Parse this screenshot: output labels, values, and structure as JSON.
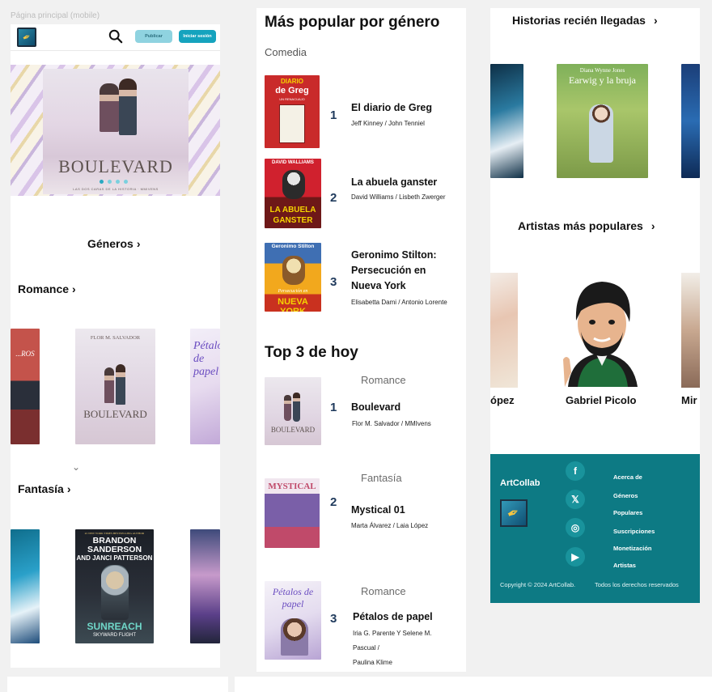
{
  "frame_label": "Página principal (mobile)",
  "header": {
    "publish_label": "Publicar",
    "login_label": "Iniciar sesión"
  },
  "hero": {
    "title": "BOULEVARD",
    "subtitle": "LAS DOS CARAS DE LA HISTORIA · MMIVENS",
    "slides": 4,
    "active_slide": 1
  },
  "genres_link": "Géneros",
  "sections": [
    {
      "title": "Romance",
      "books": [
        {
          "label": "...ROS",
          "color": "#c4534b"
        },
        {
          "label": "BOULEVARD",
          "author": "FLOR M. SALVADOR"
        },
        {
          "label": "Pétalos de papel",
          "color": "#6a4cc0"
        }
      ]
    },
    {
      "title": "Fantasía",
      "books": [
        {
          "label": "",
          "color": "#2aa0c9"
        },
        {
          "label": "SUNREACH",
          "author": "BRANDON SANDERSON",
          "co_author": "AND JANCI PATTERSON",
          "tagline": "SKYWARD FLIGHT",
          "top_line": "#1 NEW YORK TIMES BESTSELLING AUTHOR"
        },
        {
          "label": "",
          "color": "#3e4a7a"
        }
      ]
    }
  ],
  "popular_by_genre": {
    "title": "Más popular por género",
    "genre": "Comedia",
    "items": [
      {
        "rank": "1",
        "title": "El diario de Greg",
        "authors": "Jeff Kinney / John Tenniel",
        "cover_lines": [
          "DIARIO",
          "de Greg",
          "UN RENACUAJO"
        ],
        "cover_color": "#c92a2a"
      },
      {
        "rank": "2",
        "title": "La abuela ganster",
        "authors": "David Williams / Lisbeth Zwerger",
        "cover_lines": [
          "DAVID WALLIAMS",
          "LA ABUELA",
          "GANSTER"
        ],
        "cover_color": "#d0212e"
      },
      {
        "rank": "3",
        "title_lines": [
          "Geronimo Stilton:",
          "Persecución en",
          "Nueva York"
        ],
        "authors": "Elisabetta Dami / Antonio Lorente",
        "cover_lines": [
          "Geronimo Stilton",
          "Persecución en",
          "NUEVA YORK"
        ],
        "cover_color": "#f2a81d"
      }
    ]
  },
  "top_today": {
    "title": "Top 3 de hoy",
    "items": [
      {
        "rank": "1",
        "genre": "Romance",
        "title": "Boulevard",
        "authors": "Flor M. Salvador / MMIvens",
        "cover_label": "BOULEVARD"
      },
      {
        "rank": "2",
        "genre": "Fantasía",
        "title": "Mystical 01",
        "authors": "Marta Álvarez / Laia López",
        "cover_label": "MYSTICAL"
      },
      {
        "rank": "3",
        "genre": "Romance",
        "title": "Pétalos de papel",
        "authors_lines": [
          "Iria G. Parente Y Selene M.",
          "Pascual /",
          "Paulina Klime"
        ],
        "cover_label": "Pétalos de papel"
      }
    ]
  },
  "recent": {
    "title": "Historias recién llegadas",
    "featured_author": "Diana Wynne Jones",
    "featured_title": "Earwig y la bruja"
  },
  "artists": {
    "title": "Artistas más populares",
    "names": [
      "ópez",
      "Gabriel Picolo",
      "Mir"
    ]
  },
  "footer": {
    "brand": "ArtCollab",
    "links": [
      "Acerca de",
      "Géneros",
      "Populares",
      "Suscripciones",
      "Monetización",
      "Artistas"
    ],
    "social": [
      "f",
      "𝕏",
      "◎",
      "▶"
    ],
    "copyright": "Copyright © 2024 ArtCollab.",
    "rights": "Todos los derechos reservados"
  }
}
